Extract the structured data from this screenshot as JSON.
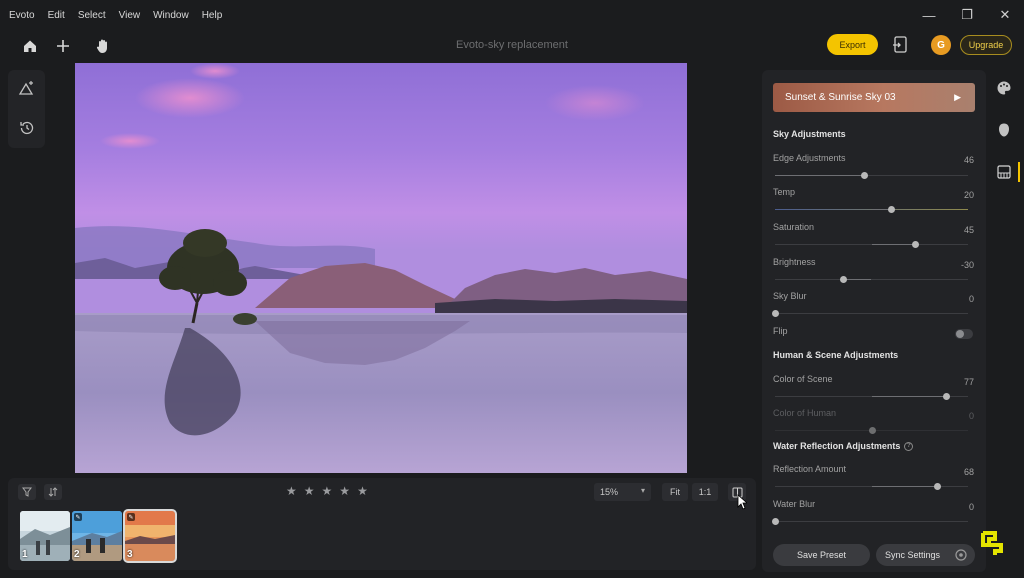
{
  "menu": [
    "Evoto",
    "Edit",
    "Select",
    "View",
    "Window",
    "Help"
  ],
  "window_controls": {
    "minimize": "—",
    "maximize": "❐",
    "close": "✕"
  },
  "toolbar": {
    "title": "Evoto-sky replacement",
    "export_label": "Export",
    "avatar_initial": "G",
    "upgrade_label": "Upgrade"
  },
  "filmstrip": {
    "rating": 0,
    "zoom": "15%",
    "fit_label": "Fit",
    "one_to_one_label": "1:1",
    "thumbnails": [
      {
        "number": "1",
        "active": false
      },
      {
        "number": "2",
        "active": false
      },
      {
        "number": "3",
        "active": true
      }
    ]
  },
  "panel": {
    "preset_name": "Sunset & Sunrise Sky 03",
    "sky_section": "Sky Adjustments",
    "human_section": "Human & Scene Adjustments",
    "water_section": "Water Reflection Adjustments",
    "sliders": {
      "edge": {
        "label": "Edge Adjustments",
        "value": "46",
        "fraction": 0.46,
        "bipolar": false
      },
      "temp": {
        "label": "Temp",
        "value": "20",
        "fraction": 0.6,
        "bipolar": true
      },
      "saturation": {
        "label": "Saturation",
        "value": "45",
        "fraction": 0.725,
        "bipolar": true
      },
      "brightness": {
        "label": "Brightness",
        "value": "-30",
        "fraction": 0.35,
        "bipolar": true
      },
      "sky_blur": {
        "label": "Sky Blur",
        "value": "0",
        "fraction": 0.0,
        "bipolar": false
      },
      "color_scene": {
        "label": "Color of Scene",
        "value": "77",
        "fraction": 0.885,
        "bipolar": true
      },
      "color_human": {
        "label": "Color of Human",
        "value": "0",
        "fraction": 0.5,
        "bipolar": true
      },
      "reflection": {
        "label": "Reflection Amount",
        "value": "68",
        "fraction": 0.84,
        "bipolar": true
      },
      "water_blur": {
        "label": "Water Blur",
        "value": "0",
        "fraction": 0.0,
        "bipolar": false
      }
    },
    "flip_label": "Flip",
    "flip_on": false,
    "save_preset_label": "Save Preset",
    "sync_settings_label": "Sync Settings"
  },
  "colors": {
    "accent": "#f4c400",
    "panel": "#222326",
    "background": "#1b1c1e"
  }
}
